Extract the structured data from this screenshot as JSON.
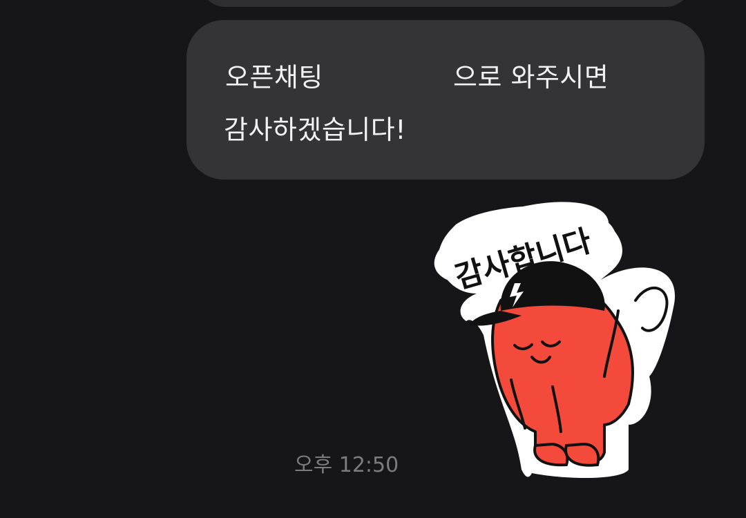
{
  "chat": {
    "previous_bubble": "",
    "message": {
      "line1_part1": "오픈채팅",
      "line1_part2": "으로 와주시면",
      "line2": "감사하겠습니다!"
    },
    "sticker": {
      "text": "감사합니다",
      "icon": "thank-you-sticker-icon"
    },
    "timestamp": "오후 12:50"
  },
  "colors": {
    "background": "#161618",
    "bubble": "#343436",
    "text": "#f2f2f2",
    "timestamp": "#7c7c80",
    "sticker_body": "#f44a3c"
  }
}
